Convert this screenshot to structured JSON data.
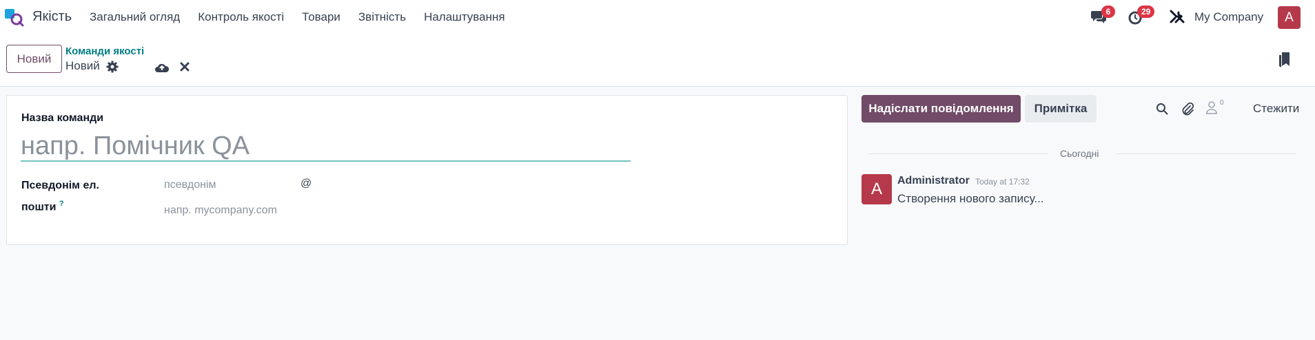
{
  "navbar": {
    "app_name": "Якість",
    "menu": [
      "Загальний огляд",
      "Контроль якості",
      "Товари",
      "Звітність",
      "Налаштування"
    ],
    "messages_count": "6",
    "activities_count": "29",
    "company": "My Company",
    "user_initial": "A"
  },
  "control_panel": {
    "new_button": "Новий",
    "breadcrumb": "Команди якості",
    "record_name": "Новий"
  },
  "form": {
    "team_name_label": "Назва команди",
    "team_name_placeholder": "напр. Помічник QA",
    "alias_label_line1": "Псевдонім ел.",
    "alias_label_line2": "пошти",
    "help_mark": "?",
    "alias_placeholder": "псевдонім",
    "at_sign": "@",
    "domain_placeholder": "напр. mycompany.com"
  },
  "chatter": {
    "send_message_button": "Надіслати повідомлення",
    "log_note_button": "Примітка",
    "follower_count": "0",
    "follow_button": "Стежити",
    "separator_label": "Сьогодні",
    "message": {
      "avatar_initial": "A",
      "author": "Administrator",
      "date": "Today at 17:32",
      "body": "Створення нового запису..."
    }
  },
  "colors": {
    "brand": "#714b67",
    "accent_teal": "#017e84",
    "badge_red": "#dc3545",
    "avatar_red": "#b5394a"
  }
}
